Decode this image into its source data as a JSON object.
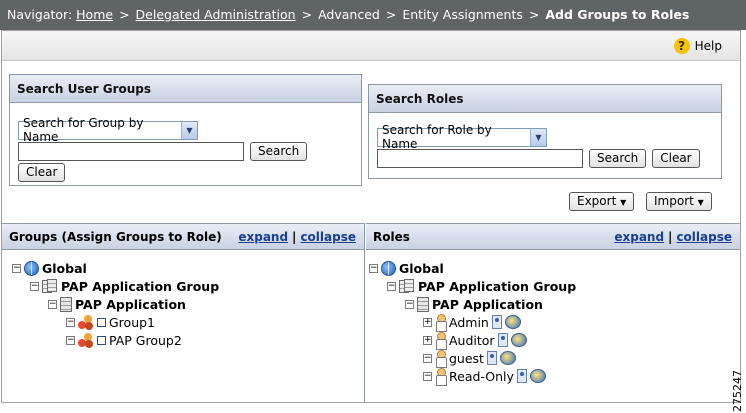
{
  "navigator": {
    "prefix": "Navigator:",
    "home": "Home",
    "delegated": "Delegated Administration",
    "advanced": "Advanced",
    "entity": "Entity Assignments",
    "current": "Add Groups to Roles",
    "separator": ">"
  },
  "toolbar": {
    "help_label": "Help",
    "help_icon": "help-icon"
  },
  "search_groups": {
    "title": "Search User Groups",
    "select_value": "Search for Group by Name",
    "input_value": "",
    "search_label": "Search",
    "clear_label": "Clear"
  },
  "search_roles": {
    "title": "Search Roles",
    "select_value": "Search for Role by Name",
    "input_value": "",
    "search_label": "Search",
    "clear_label": "Clear"
  },
  "actions": {
    "export_label": "Export",
    "import_label": "Import"
  },
  "groups_tree": {
    "title": "Groups (Assign Groups to Role)",
    "expand": "expand",
    "collapse": "collapse",
    "divider": "|",
    "nodes": [
      "Global",
      "PAP Application Group",
      "PAP Application",
      "Group1",
      "PAP Group2"
    ]
  },
  "roles_tree": {
    "title": "Roles",
    "expand": "expand",
    "collapse": "collapse",
    "divider": "|",
    "nodes": [
      "Global",
      "PAP Application Group",
      "PAP Application",
      "Admin",
      "Auditor",
      "guest",
      "Read-Only"
    ]
  },
  "figure_id": "275247"
}
